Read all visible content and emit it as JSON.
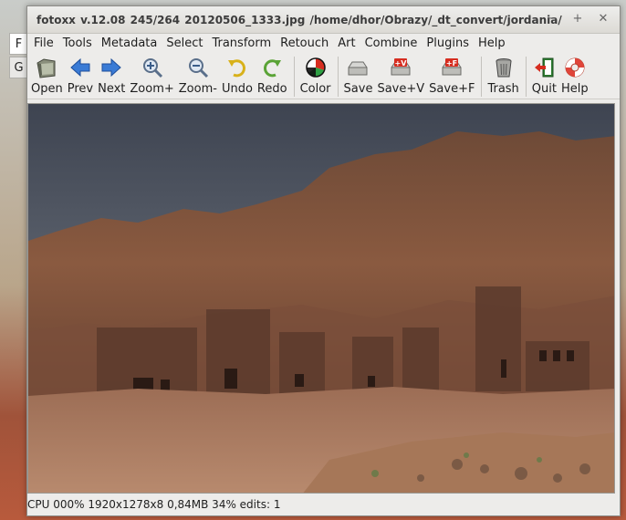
{
  "window": {
    "title": "fotoxx v.12.08   245/264  20120506_1333.jpg  /home/dhor/Obrazy/_dt_convert/jordania/"
  },
  "background_tabs": [
    "F",
    "G"
  ],
  "menu": [
    "File",
    "Tools",
    "Metadata",
    "Select",
    "Transform",
    "Retouch",
    "Art",
    "Combine",
    "Plugins",
    "Help"
  ],
  "toolbar": {
    "open": "Open",
    "prev": "Prev",
    "next": "Next",
    "zoom_in": "Zoom+",
    "zoom_out": "Zoom-",
    "undo": "Undo",
    "redo": "Redo",
    "color": "Color",
    "save": "Save",
    "save_v": "Save+V",
    "save_f": "Save+F",
    "trash": "Trash",
    "quit": "Quit",
    "help": "Help"
  },
  "image": {
    "description_icon": "photo-petra-rock-tombs"
  },
  "status": {
    "text": "CPU 000%  1920x1278x8 0,84MB 34%  edits: 1"
  },
  "colors": {
    "accent_blue": "#2f6fd0",
    "accent_red": "#d62d20",
    "window_bg": "#edecea"
  }
}
